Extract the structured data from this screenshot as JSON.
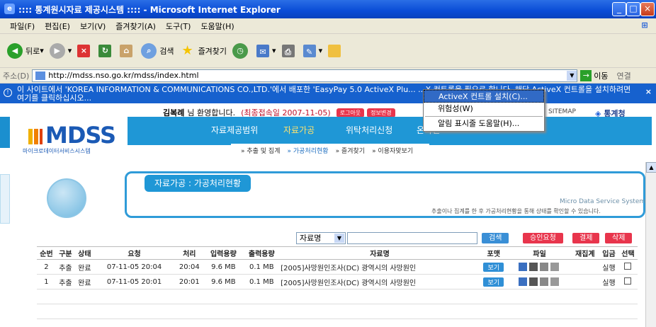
{
  "window": {
    "title": ":::: 통계원시자료 제공시스템 :::: - Microsoft Internet Explorer"
  },
  "menu": [
    "파일(F)",
    "편집(E)",
    "보기(V)",
    "즐겨찾기(A)",
    "도구(T)",
    "도움말(H)"
  ],
  "toolbar": {
    "back": "뒤로",
    "search": "검색",
    "favorites": "즐겨찾기"
  },
  "address": {
    "label": "주소(D)",
    "url": "http://mdss.nso.go.kr/mdss/index.html",
    "go": "이동",
    "links": "연결"
  },
  "infobar": {
    "text": "이 사이트에서 'KOREA INFORMATION & COMMUNICATIONS CO.,LTD.'에서 배포한 'EasyPay 5.0 ActiveX Plu... ...X 컨트롤을 필요로 합니다. 해당 ActiveX 컨트롤을 설치하려면 여기를 클릭하십시오..."
  },
  "contextmenu": {
    "items": [
      "ActiveX 컨트롤 설치(C)...",
      "위험성(W)",
      "알림 표시줄 도움말(H)..."
    ]
  },
  "user": {
    "name": "김복례",
    "greet": "님 환영합니다.",
    "last": "(최종접속일 2007-11-05)",
    "logout": "로그아웃",
    "info": "정보변경"
  },
  "topright": "SITEMAP",
  "stat": {
    "name": "통계청"
  },
  "logo": {
    "text": "MDSS",
    "sub": "마이크로데이터서비스시스템"
  },
  "nav": {
    "items": [
      "자료제공범위",
      "자료가공",
      "위탁처리신청",
      "온라인"
    ]
  },
  "subnav": [
    "» 추출 및 집계",
    "» 가공처리현황",
    "» 즐겨찾기",
    "» 이용자맞보기"
  ],
  "hero": {
    "title": "자료가공 : 가공처리현황",
    "mds": "Micro Data Service System",
    "desc": "추출이나 집계를 한 후 가공처리현황을 통해 상태를 확인할 수 있습니다."
  },
  "search": {
    "select": "자료명",
    "buttons": [
      "검색",
      "승인요청",
      "결제",
      "삭제"
    ]
  },
  "table": {
    "headers": [
      "순번",
      "구분",
      "상태",
      "요청",
      "처리",
      "입력용량",
      "출력용량",
      "자료명",
      "포맷",
      "파일",
      "재집계",
      "입금",
      "선택"
    ],
    "rows": [
      [
        "2",
        "추출",
        "완료",
        "07-11-05 20:04",
        "20:04",
        "9.6 MB",
        "0.1 MB",
        "[2005]사망원인조사(DC) 광역시의 사망원인",
        "보기",
        "",
        "",
        "실행",
        ""
      ],
      [
        "1",
        "추출",
        "완료",
        "07-11-05 20:01",
        "20:01",
        "9.6 MB",
        "0.1 MB",
        "[2005]사망원인조사(DC) 광역시의 사망원인",
        "보기",
        "",
        "",
        "실행",
        ""
      ]
    ]
  },
  "colors": {
    "titlebar": "#0a4cd6",
    "infobar": "#1661ce",
    "nav": "#1f97d6",
    "accent": "#e8354c"
  }
}
